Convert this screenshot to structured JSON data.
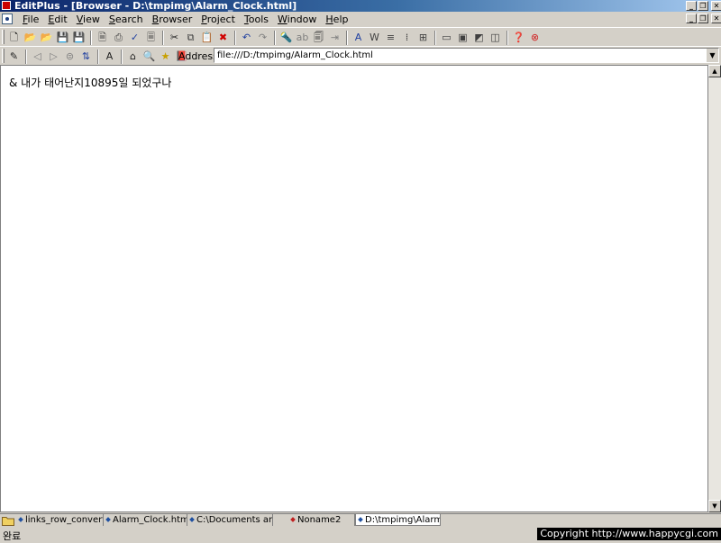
{
  "window": {
    "title": "EditPlus - [Browser - D:\\tmpimg\\Alarm_Clock.html]",
    "controls": [
      "_",
      "❐",
      "✕"
    ]
  },
  "menu": {
    "items": [
      {
        "accel": "F",
        "rest": "ile"
      },
      {
        "accel": "E",
        "rest": "dit"
      },
      {
        "accel": "V",
        "rest": "iew"
      },
      {
        "accel": "S",
        "rest": "earch"
      },
      {
        "accel": "B",
        "rest": "rowser"
      },
      {
        "accel": "P",
        "rest": "roject"
      },
      {
        "accel": "T",
        "rest": "ools"
      },
      {
        "accel": "W",
        "rest": "indow"
      },
      {
        "accel": "H",
        "rest": "elp"
      }
    ],
    "doc_controls": [
      "_",
      "❐",
      "✕"
    ]
  },
  "toolbar": {
    "icons": [
      {
        "name": "new-file-icon",
        "glyph": "🗋",
        "color": "#000000"
      },
      {
        "name": "open-file-icon",
        "glyph": "📂",
        "color": "#c8a000"
      },
      {
        "name": "open-remote-icon",
        "glyph": "📂",
        "color": "#c8a000"
      },
      {
        "name": "save-icon",
        "glyph": "💾",
        "color": "#404040"
      },
      {
        "name": "save-all-icon",
        "glyph": "💾",
        "color": "#208040"
      },
      {
        "name": "sep",
        "glyph": "",
        "color": ""
      },
      {
        "name": "print-preview-icon",
        "glyph": "🗎",
        "color": "#404040"
      },
      {
        "name": "print-icon",
        "glyph": "⎙",
        "color": "#404040"
      },
      {
        "name": "spell-check-icon",
        "glyph": "✓",
        "color": "#2040a0"
      },
      {
        "name": "document-icon",
        "glyph": "🗏",
        "color": "#404040"
      },
      {
        "name": "sep",
        "glyph": "",
        "color": ""
      },
      {
        "name": "cut-icon",
        "glyph": "✂",
        "color": "#202020"
      },
      {
        "name": "copy-icon",
        "glyph": "⧉",
        "color": "#404040"
      },
      {
        "name": "paste-icon",
        "glyph": "📋",
        "color": "#806020"
      },
      {
        "name": "delete-icon",
        "glyph": "✖",
        "color": "#d00000"
      },
      {
        "name": "sep",
        "glyph": "",
        "color": ""
      },
      {
        "name": "undo-icon",
        "glyph": "↶",
        "color": "#2040a0"
      },
      {
        "name": "redo-icon",
        "glyph": "↷",
        "color": "#808080"
      },
      {
        "name": "sep",
        "glyph": "",
        "color": ""
      },
      {
        "name": "find-icon",
        "glyph": "🔦",
        "color": "#806020"
      },
      {
        "name": "replace-icon",
        "glyph": "ab",
        "color": "#808080"
      },
      {
        "name": "find-in-files-icon",
        "glyph": "🗐",
        "color": "#404040"
      },
      {
        "name": "goto-icon",
        "glyph": "⇥",
        "color": "#808080"
      },
      {
        "name": "sep",
        "glyph": "",
        "color": ""
      },
      {
        "name": "font-icon",
        "glyph": "A",
        "color": "#2040a0"
      },
      {
        "name": "word-wrap-icon",
        "glyph": "W",
        "color": "#404040"
      },
      {
        "name": "line-number-icon",
        "glyph": "≡",
        "color": "#404040"
      },
      {
        "name": "ruler-icon",
        "glyph": "⁞",
        "color": "#404040"
      },
      {
        "name": "column-select-icon",
        "glyph": "⊞",
        "color": "#404040"
      },
      {
        "name": "sep",
        "glyph": "",
        "color": ""
      },
      {
        "name": "output-window-icon",
        "glyph": "▭",
        "color": "#404040"
      },
      {
        "name": "cliptext-icon",
        "glyph": "▣",
        "color": "#404040"
      },
      {
        "name": "directory-icon",
        "glyph": "◩",
        "color": "#404040"
      },
      {
        "name": "browser-icon",
        "glyph": "◫",
        "color": "#404040"
      },
      {
        "name": "sep",
        "glyph": "",
        "color": ""
      },
      {
        "name": "help-icon",
        "glyph": "❓",
        "color": "#2040a0"
      },
      {
        "name": "close-icon",
        "glyph": "⊗",
        "color": "#d02020"
      }
    ]
  },
  "browser_toolbar": {
    "icons": [
      {
        "name": "edit-pencil-icon",
        "glyph": "✎",
        "color": "#202020"
      },
      {
        "name": "sep",
        "glyph": "",
        "color": ""
      },
      {
        "name": "back-icon",
        "glyph": "◁",
        "color": "#808080"
      },
      {
        "name": "forward-icon",
        "glyph": "▷",
        "color": "#808080"
      },
      {
        "name": "stop-icon",
        "glyph": "⊜",
        "color": "#808080"
      },
      {
        "name": "refresh-icon",
        "glyph": "⇅",
        "color": "#2040a0"
      },
      {
        "name": "sep",
        "glyph": "",
        "color": ""
      },
      {
        "name": "font-size-icon",
        "glyph": "A",
        "color": "#202020"
      },
      {
        "name": "sep",
        "glyph": "",
        "color": ""
      },
      {
        "name": "home-icon",
        "glyph": "⌂",
        "color": "#202020"
      },
      {
        "name": "search-web-icon",
        "glyph": "🔍",
        "color": "#2060a0"
      },
      {
        "name": "favorites-icon",
        "glyph": "★",
        "color": "#c8a000"
      },
      {
        "name": "history-icon",
        "glyph": "📕",
        "color": "#c02020"
      }
    ],
    "address_label": "Address",
    "address_value": "file:///D:/tmpimg/Alarm_Clock.html"
  },
  "page": {
    "text": "& 내가 태어난지10895일 되었구나"
  },
  "tabs": [
    {
      "label": "links_row_convert.r",
      "color": "#2050a0",
      "active": false
    },
    {
      "label": "Alarm_Clock.html",
      "color": "#2050a0",
      "active": false
    },
    {
      "label": "C:\\Documents an",
      "color": "#2050a0",
      "active": false
    },
    {
      "label": "Noname2",
      "color": "#c02020",
      "active": false
    },
    {
      "label": "D:\\tmpimg\\Alarm",
      "color": "#2050a0",
      "active": true
    }
  ],
  "status": {
    "text": "완료",
    "copyright": "Copyright  http://www.happycgi.com"
  }
}
